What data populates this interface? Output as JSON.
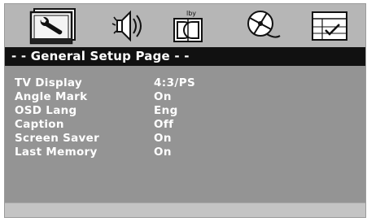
{
  "menu": {
    "tabs": [
      {
        "name": "general-setup",
        "icon": "wrench-icon",
        "selected": true
      },
      {
        "name": "audio-setup",
        "icon": "speaker-icon",
        "selected": false
      },
      {
        "name": "dolby-digital-setup",
        "icon": "dolby-icon",
        "selected": false,
        "badge": "lby"
      },
      {
        "name": "video-setup",
        "icon": "film-reel-icon",
        "selected": false
      },
      {
        "name": "preference",
        "icon": "preference-icon",
        "selected": false
      }
    ]
  },
  "page": {
    "title": "- - General Setup Page - -"
  },
  "settings": [
    {
      "label": "TV Display",
      "value": "4:3/PS"
    },
    {
      "label": "Angle Mark",
      "value": "On"
    },
    {
      "label": "OSD Lang",
      "value": "Eng"
    },
    {
      "label": "Caption",
      "value": "Off"
    },
    {
      "label": "Screen Saver",
      "value": "On"
    },
    {
      "label": "Last Memory",
      "value": "On"
    }
  ],
  "colors": {
    "background": "#b6b6b6",
    "title_bar": "#111111",
    "content": "#949494",
    "text": "#ffffff"
  }
}
